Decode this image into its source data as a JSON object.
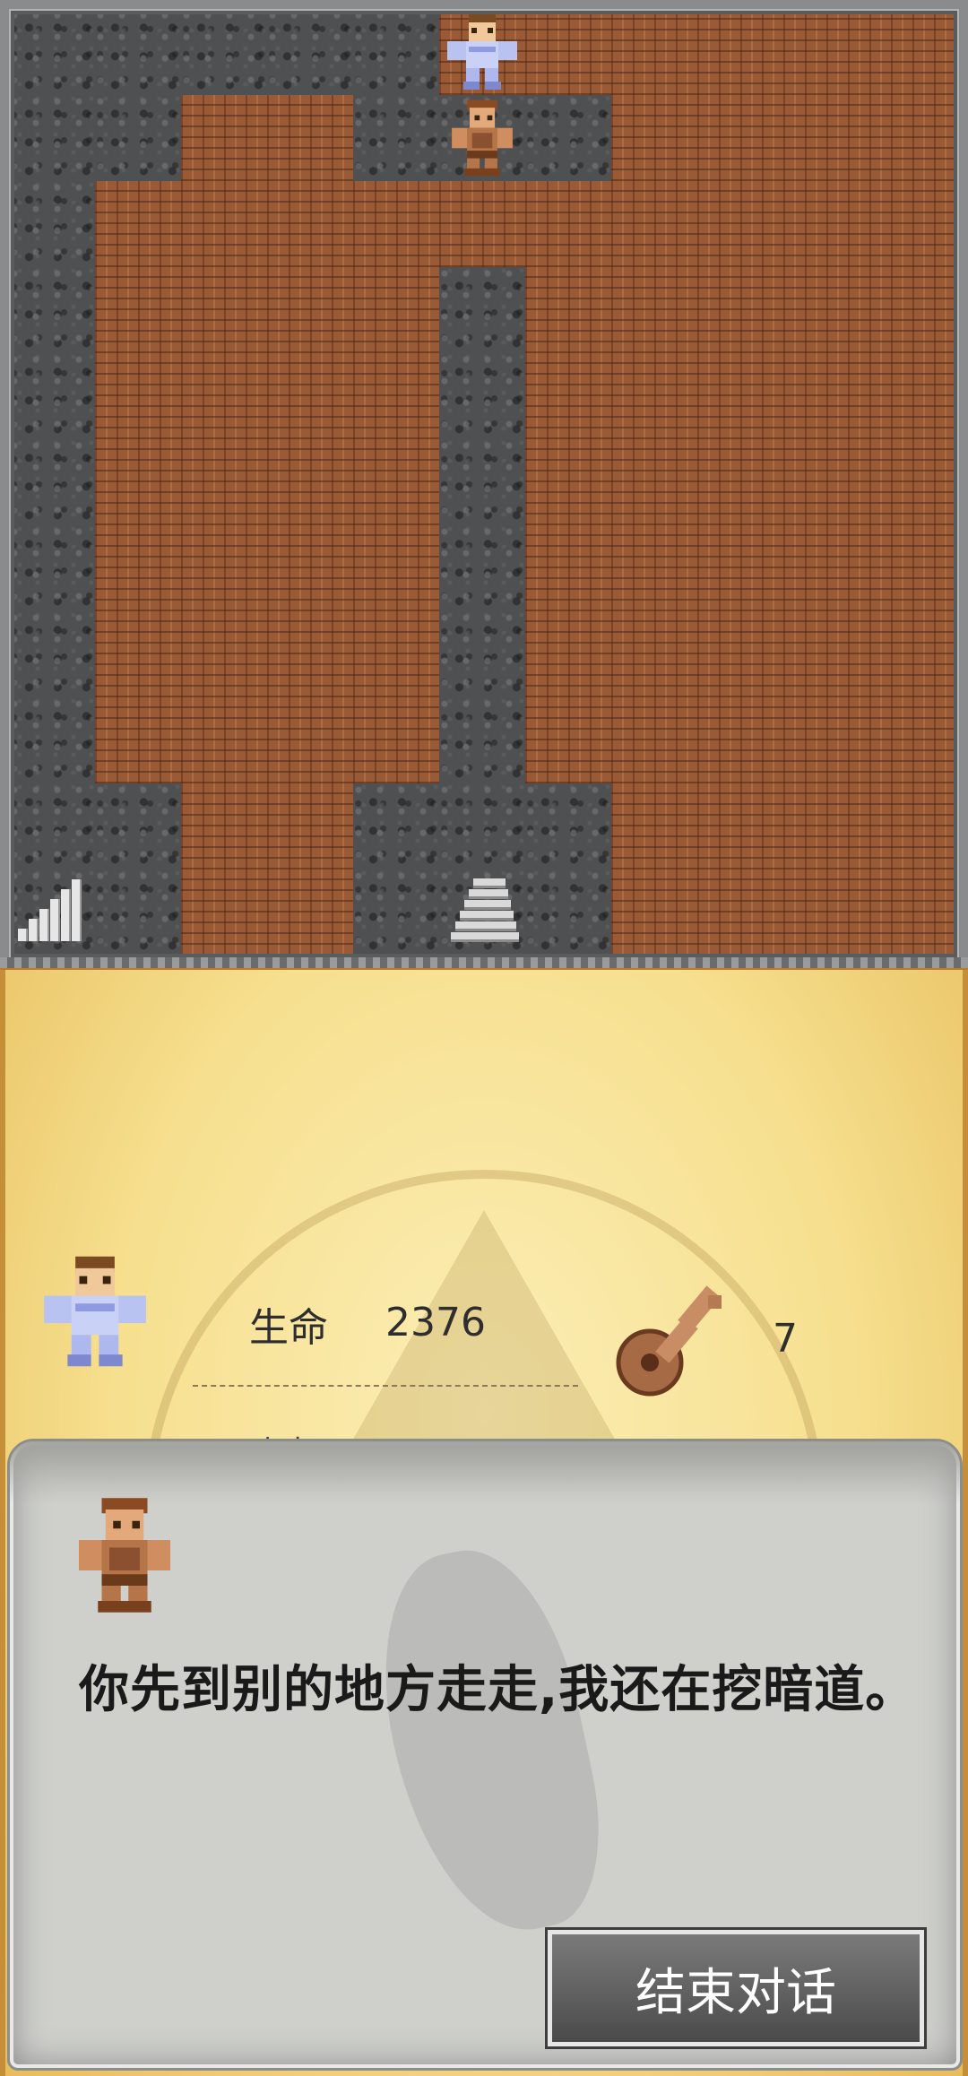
{
  "map": {
    "grid": [
      "WWWWWFFFFFF",
      "WWFFWWWFFFF",
      "WFFFFFFFFFF",
      "WFFFFWFFFFF",
      "WFFFFWFFFFF",
      "WFFFFWFFFFF",
      "WFFFFWFFFFF",
      "WFFFFWFFFFF",
      "WFFFFWFFFFF",
      "WWFFWWWFFFF",
      "WWFFWWWFFFF"
    ],
    "objects": [
      {
        "type": "hero-sprite",
        "col": 5,
        "row": 0
      },
      {
        "type": "thief-npc-sprite",
        "col": 5,
        "row": 1
      },
      {
        "type": "stairs-icon",
        "col": 5,
        "row": 10
      },
      {
        "type": "signal-icon",
        "col": 0,
        "row": 10
      }
    ]
  },
  "status": {
    "hp_label": "生命",
    "hp_value": "2376",
    "key_count": "7",
    "next_stat_peek": "攻击"
  },
  "dialog": {
    "text": "　你先到别的地方走走,我还在挖暗道。",
    "end_button_label": "结束对话"
  }
}
